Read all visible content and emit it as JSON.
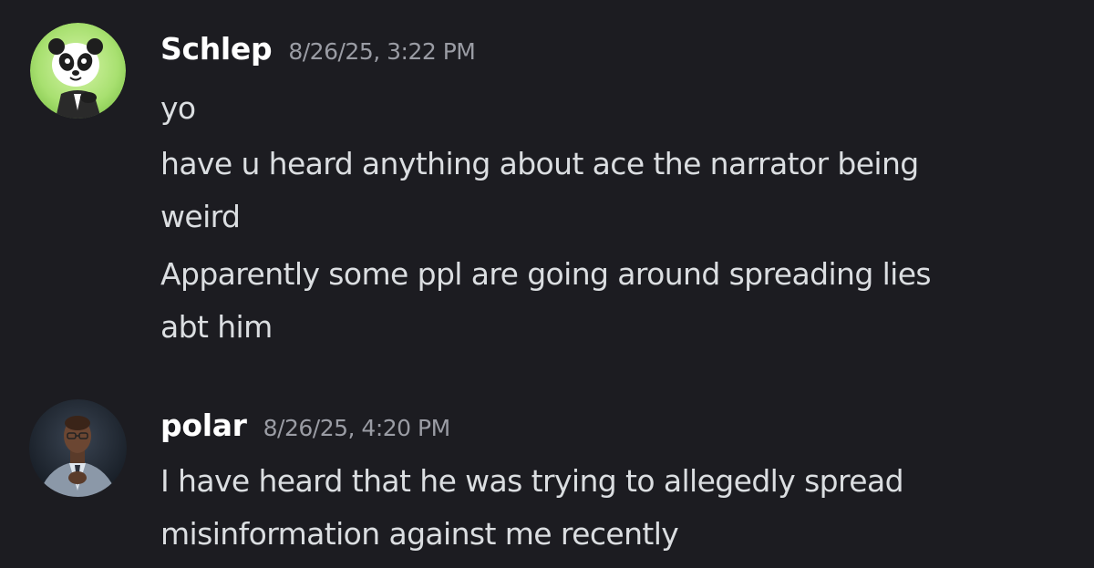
{
  "messages": [
    {
      "author": "Schlep",
      "timestamp": "8/26/25, 3:22 PM",
      "avatar_icon": "panda-avatar-icon",
      "lines": [
        "yo",
        "have u heard anything about ace the narrator being",
        "weird",
        "Apparently some ppl are going around spreading lies",
        "abt him"
      ]
    },
    {
      "author": "polar",
      "timestamp": "8/26/25, 4:20 PM",
      "avatar_icon": "man-in-suit-avatar-icon",
      "lines": [
        "I have heard that he was trying to allegedly spread",
        "misinformation against me recently"
      ]
    }
  ],
  "colors": {
    "background": "#1c1c21",
    "username": "#ffffff",
    "timestamp": "#9a9ca4",
    "message_text": "#dbdee1"
  }
}
